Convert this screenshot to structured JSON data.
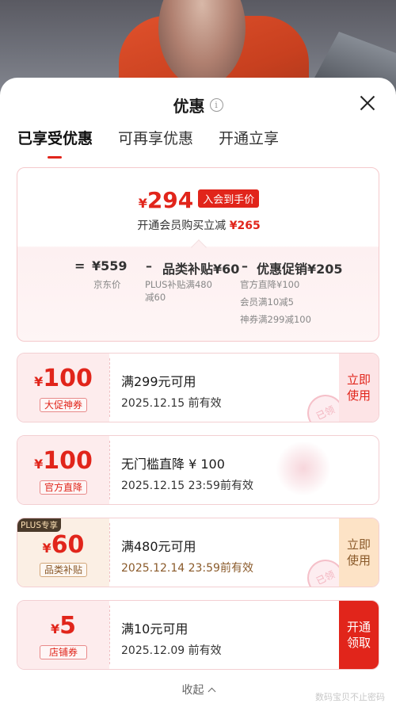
{
  "header": {
    "title": "优惠",
    "info_glyph": "i"
  },
  "tabs": [
    {
      "label": "已享受优惠",
      "active": true
    },
    {
      "label": "可再享优惠",
      "active": false
    },
    {
      "label": "开通立享",
      "active": false
    }
  ],
  "summary": {
    "yen": "¥",
    "price": "294",
    "badge": "入会到手价",
    "sub_text": "开通会员购买立减",
    "sub_amount": "¥265",
    "formula": {
      "eq": "=",
      "base": "¥559",
      "minus1": "–",
      "subsidy": "品类补贴¥60",
      "minus2": "–",
      "promo": "优惠促销¥205"
    },
    "base_note": "京东价",
    "subsidy_notes": [
      "PLUS补贴满480",
      "减60"
    ],
    "promo_notes": [
      "官方直降¥100",
      "会员满10减5",
      "神券满299减100"
    ]
  },
  "coupons": [
    {
      "yen": "¥",
      "amount": "100",
      "tag": "大促神券",
      "condition": "满299元可用",
      "validity": "2025.12.15 前有效",
      "action": [
        "立即",
        "使用"
      ],
      "stamp": "已领"
    },
    {
      "yen": "¥",
      "amount": "100",
      "tag": "官方直降",
      "condition": "无门槛直降 ¥ 100",
      "validity": "2025.12.15 23:59前有效"
    },
    {
      "yen": "¥",
      "amount": "60",
      "tag": "品类补贴",
      "plus_badge": "PLUS专享",
      "condition": "满480元可用",
      "validity": "2025.12.14 23:59前有效",
      "action": [
        "立即",
        "使用"
      ],
      "stamp": "已领"
    },
    {
      "yen": "¥",
      "amount": "5",
      "tag": "店铺券",
      "condition": "满10元可用",
      "validity": "2025.12.09 前有效",
      "action": [
        "开通",
        "领取"
      ]
    }
  ],
  "footer": {
    "collapse": "收起",
    "watermark": "数码宝贝不止密码"
  },
  "colors": {
    "accent_red": "#e1251b",
    "plus_brown": "#8a5a2a",
    "coupon_pink": "#fdeced"
  }
}
